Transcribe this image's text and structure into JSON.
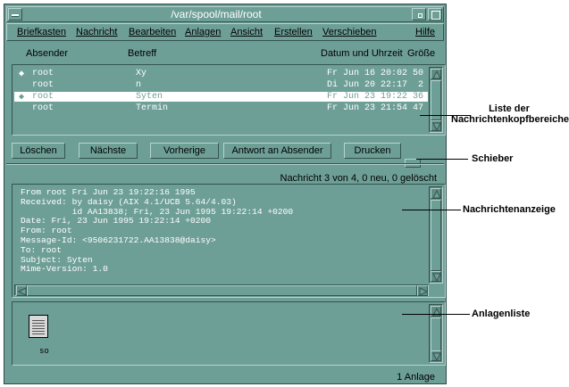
{
  "window": {
    "title": "/var/spool/mail/root"
  },
  "menubar": [
    "Briefkasten",
    "Nachricht",
    "Bearbeiten",
    "Anlagen",
    "Ansicht",
    "Erstellen",
    "Verschieben",
    "Hilfe"
  ],
  "list_headers": {
    "sender": "Absender",
    "subject": "Betreff",
    "date": "Datum und Uhrzeit",
    "size": "Größe"
  },
  "messages": [
    {
      "marker": "◆",
      "sender": "root",
      "subject": "Xy",
      "date": "Fr Jun 16 20:02",
      "size": "50"
    },
    {
      "marker": "",
      "sender": "root",
      "subject": "n",
      "date": "Di Jun 20 22:17",
      "size": "2"
    },
    {
      "marker": "◆",
      "sender": "root",
      "subject": "Syten",
      "date": "Fr Jun 23 19:22",
      "size": "36"
    },
    {
      "marker": "",
      "sender": "root",
      "subject": "Termin",
      "date": "Fr Jun 23 21:54",
      "size": "47"
    }
  ],
  "buttons": {
    "delete": "Löschen",
    "next": "Nächste",
    "previous": "Vorherige",
    "reply": "Antwort an Absender",
    "print": "Drucken"
  },
  "status": "Nachricht 3 von 4, 0 neu, 0 gelöscht",
  "message_body": "From root Fri Jun 23 19:22:16 1995\nReceived: by daisy (AIX 4.1/UCB 5.64/4.03)\n          id AA13838; Fri, 23 Jun 1995 19:22:14 +0200\nDate: Fri, 23 Jun 1995 19:22:14 +0200\nFrom: root\nMessage-Id: <9506231722.AA13838@daisy>\nTo: root\nSubject: Syten\nMime-Version: 1.0",
  "attachment": {
    "name": "so",
    "count": "1 Anlage"
  },
  "callouts": {
    "list": "Liste der Nachrichtenkopfbereiche",
    "slider": "Schieber",
    "viewer": "Nachrichtenanzeige",
    "attachments": "Anlagenliste"
  }
}
